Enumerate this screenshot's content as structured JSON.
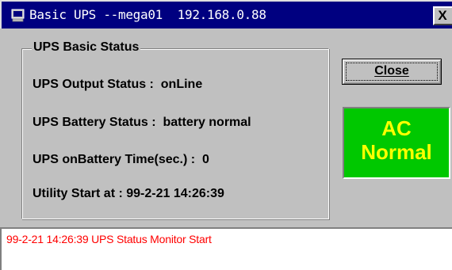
{
  "window": {
    "title": "Basic UPS --mega01  192.168.0.88",
    "close_glyph": "X",
    "icon": "monitor-icon"
  },
  "group": {
    "title": "UPS Basic Status",
    "lines": [
      "UPS Output Status :  onLine",
      "UPS Battery Status :  battery normal",
      "UPS onBattery Time(sec.) :  0",
      "Utility Start at : 99-2-21 14:26:39"
    ]
  },
  "close_button": {
    "label": "Close"
  },
  "power_indicator": {
    "line1": "AC",
    "line2": "Normal",
    "background": "#00c800",
    "text_color": "#ffff00"
  },
  "log": {
    "lines": [
      "99-2-21 14:26:39 UPS Status Monitor Start"
    ],
    "text_color": "#ff0000"
  },
  "colors": {
    "titlebar": "#000080",
    "face": "#c0c0c0"
  }
}
